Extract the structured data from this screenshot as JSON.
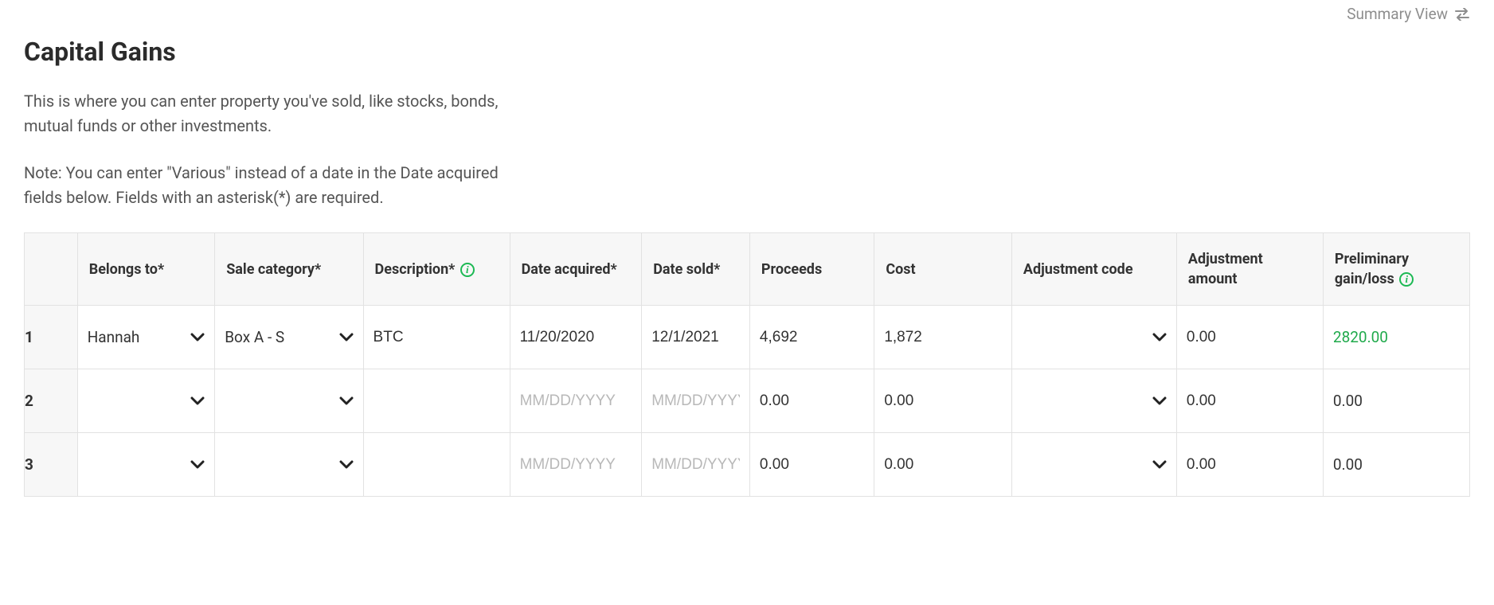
{
  "header": {
    "summary_view_label": "Summary View"
  },
  "title": "Capital Gains",
  "intro": {
    "p1": "This is where you can enter property you've sold, like stocks, bonds, mutual funds or other investments.",
    "p2": "Note: You can enter \"Various\" instead of a date in the Date acquired fields below. Fields with an asterisk(*) are required."
  },
  "columns": {
    "belongs_to": "Belongs to*",
    "sale_category": "Sale category*",
    "description": "Description*",
    "date_acquired": "Date acquired*",
    "date_sold": "Date sold*",
    "proceeds": "Proceeds",
    "cost": "Cost",
    "adjustment_code": "Adjustment code",
    "adjustment_amount": "Adjustment amount",
    "prelim_gain_loss": "Preliminary gain/loss"
  },
  "placeholders": {
    "date": "MM/DD/YYYY"
  },
  "rows": [
    {
      "num": "1",
      "belongs_to": "Hannah",
      "sale_category": "Box A - S",
      "description": "BTC",
      "date_acquired": "11/20/2020",
      "date_sold": "12/1/2021",
      "proceeds": "4,692",
      "cost": "1,872",
      "adjustment_code": "",
      "adjustment_amount": "0.00",
      "prelim": "2820.00",
      "prelim_positive": true
    },
    {
      "num": "2",
      "belongs_to": "",
      "sale_category": "",
      "description": "",
      "date_acquired": "",
      "date_sold": "",
      "proceeds": "0.00",
      "cost": "0.00",
      "adjustment_code": "",
      "adjustment_amount": "0.00",
      "prelim": "0.00",
      "prelim_positive": false
    },
    {
      "num": "3",
      "belongs_to": "",
      "sale_category": "",
      "description": "",
      "date_acquired": "",
      "date_sold": "",
      "proceeds": "0.00",
      "cost": "0.00",
      "adjustment_code": "",
      "adjustment_amount": "0.00",
      "prelim": "0.00",
      "prelim_positive": false
    }
  ]
}
